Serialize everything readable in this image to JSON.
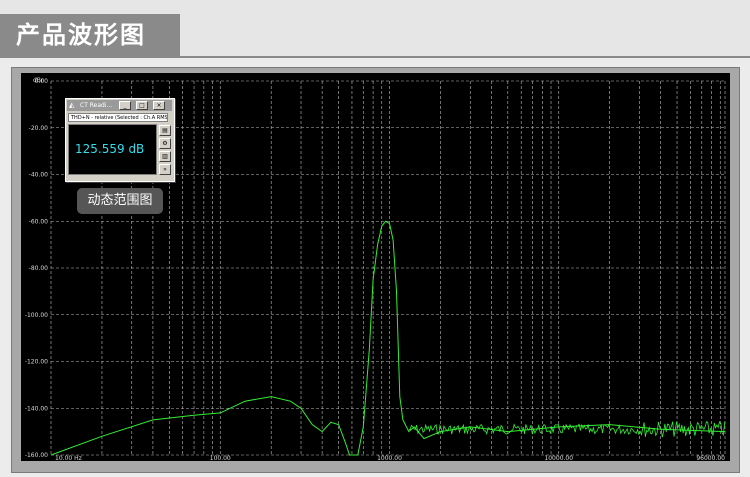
{
  "header": {
    "title": "产品波形图"
  },
  "analyzer": {
    "y_unit": "dBr",
    "y_ticks": [
      "0.00",
      "-20.00",
      "-40.00",
      "-60.00",
      "-80.00",
      "-100.00",
      "-120.00",
      "-140.00",
      "-160.00"
    ],
    "x_ticks": [
      "10.00 Hz",
      "100.00",
      "1000.00",
      "10000.00",
      "96000.00"
    ],
    "trace_color": "#33ee33",
    "grid_color": "#bdbdbd"
  },
  "reading_window": {
    "title": "CT Readi...",
    "minimize": "_",
    "maximize": "□",
    "close": "×",
    "subtitle": "THD+N - relative (Selected : Ch.A RMS",
    "value": "125.559 dB",
    "value_color": "#33ddee"
  },
  "annotation": {
    "label": "动态范围图"
  },
  "chart_data": {
    "type": "line",
    "xlabel": "",
    "ylabel": "dBr",
    "xscale": "log",
    "xlim": [
      10,
      96000
    ],
    "ylim": [
      -160,
      0
    ],
    "series": [
      {
        "x": [
          10,
          20,
          40,
          70,
          100,
          140,
          200,
          260,
          300,
          350,
          400,
          450,
          500,
          550,
          580,
          650,
          700,
          760,
          800,
          850,
          900,
          950,
          1000,
          1050,
          1100,
          1150,
          1200,
          1300,
          1400,
          1600,
          2000,
          3000,
          5000,
          10000,
          20000,
          40000,
          96000
        ],
        "y": [
          -160,
          -152,
          -145,
          -143,
          -142,
          -137,
          -135,
          -137,
          -140,
          -147,
          -150,
          -146,
          -147,
          -155,
          -160,
          -160,
          -148,
          -115,
          -85,
          -70,
          -62,
          -60,
          -61,
          -68,
          -90,
          -135,
          -145,
          -150,
          -148,
          -153,
          -150,
          -148,
          -150,
          -148,
          -147,
          -149,
          -150
        ]
      }
    ]
  }
}
